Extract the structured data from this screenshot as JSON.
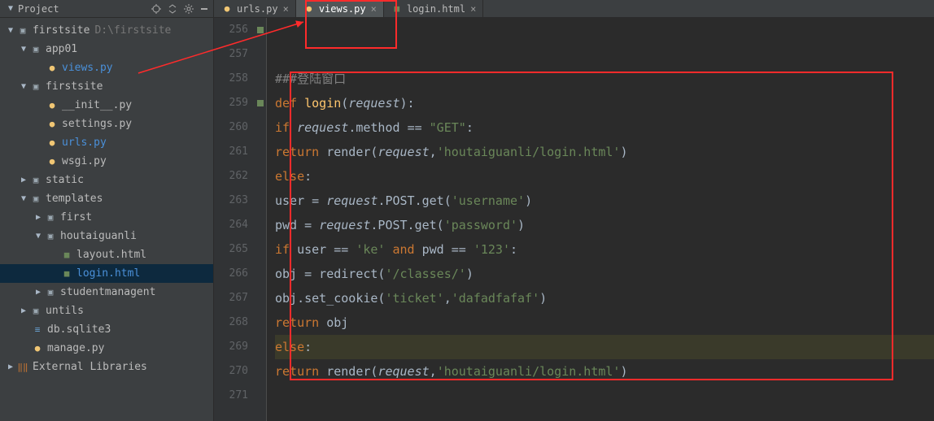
{
  "sidebar": {
    "title": "Project",
    "project": {
      "name": "firstsite",
      "path": "D:\\firstsite"
    },
    "tree": {
      "app01": "app01",
      "views_py": "views.py",
      "firstsite_dir": "firstsite",
      "init_py": "__init__.py",
      "settings_py": "settings.py",
      "urls_py": "urls.py",
      "wsgi_py": "wsgi.py",
      "static": "static",
      "templates": "templates",
      "first": "first",
      "houtaiguanli": "houtaiguanli",
      "layout_html": "layout.html",
      "login_html": "login.html",
      "studentmanagent": "studentmanagent",
      "untils": "untils",
      "db": "db.sqlite3",
      "manage_py": "manage.py",
      "ext_lib": "External Libraries"
    }
  },
  "tabs": {
    "t1": "urls.py",
    "t2": "views.py",
    "t3": "login.html"
  },
  "code": {
    "comment": "###登陆窗口",
    "l259": {
      "def": "def",
      "fn": "login",
      "p": "request"
    },
    "l260": {
      "if": "if",
      "r": "request",
      "m": ".method",
      "eq": "==",
      "s": "\"GET\""
    },
    "l261": {
      "ret": "return",
      "fn": "render",
      "r": "request",
      "s": "'houtaiguanli/login.html'"
    },
    "l262": {
      "else": "else"
    },
    "l263": {
      "u": "user",
      "eq": "=",
      "r": "request",
      "rest": ".POST.get(",
      "s": "'username'",
      "end": ")"
    },
    "l264": {
      "u": "pwd",
      "eq": "=",
      "r": "request",
      "rest": ".POST.get(",
      "s": "'password'",
      "end": ")"
    },
    "l265": {
      "if": "if",
      "u": "user ==",
      "s1": "'ke'",
      "and": "and",
      "p": "pwd ==",
      "s2": "'123'"
    },
    "l266": {
      "o": "obj = redirect(",
      "s": "'/classes/'",
      "end": ")"
    },
    "l267": {
      "o": "obj.set_cookie(",
      "s1": "'ticket'",
      "c": ",",
      "s2": "'dafadfafaf'",
      "end": ")"
    },
    "l268": {
      "ret": "return",
      "o": "obj"
    },
    "l269": {
      "else": "else"
    },
    "l270": {
      "ret": "return",
      "fn": "render",
      "r": "request",
      "s": "'houtaiguanli/login.html'",
      "end": ")"
    }
  },
  "gutter": [
    "256",
    "257",
    "258",
    "259",
    "260",
    "261",
    "262",
    "263",
    "264",
    "265",
    "266",
    "267",
    "268",
    "269",
    "270",
    "271"
  ]
}
